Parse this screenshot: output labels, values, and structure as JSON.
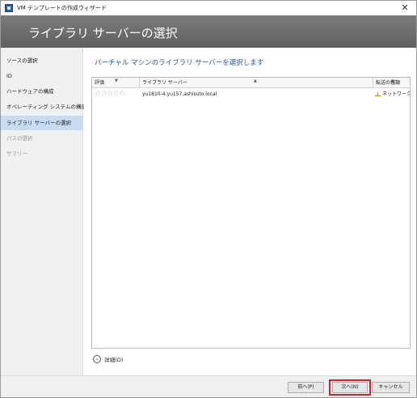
{
  "window": {
    "title": "VM テンプレートの作成ウィザード",
    "close": "✕"
  },
  "banner": {
    "title": "ライブラリ サーバーの選択"
  },
  "nav": {
    "items": [
      {
        "label": "ソースの選択"
      },
      {
        "label": "ID"
      },
      {
        "label": "ハードウェアの構成"
      },
      {
        "label": "オペレーティング システムの構成"
      },
      {
        "label": "ライブラリ サーバーの選択"
      },
      {
        "label": "パスの選択"
      },
      {
        "label": "サマリー"
      }
    ],
    "active_index": 4
  },
  "main": {
    "heading": "バーチャル マシンのライブラリ サーバーを選択します",
    "columns": {
      "rating": "評価",
      "library_server": "ライブラリ サーバー",
      "transfer_type": "転送の種類"
    },
    "rows": [
      {
        "rating": "☆☆☆☆☆",
        "library_server": "yu1810-4.yu157.ashisuto.local",
        "transfer_type": "ネットワーク"
      }
    ],
    "details": {
      "icon": "chevron-down-icon",
      "label": "詳細(D)"
    }
  },
  "footer": {
    "back": "前へ(P)",
    "next": "次へ(N)",
    "cancel": "キャンセル",
    "highlight_color": "#d2232a"
  }
}
